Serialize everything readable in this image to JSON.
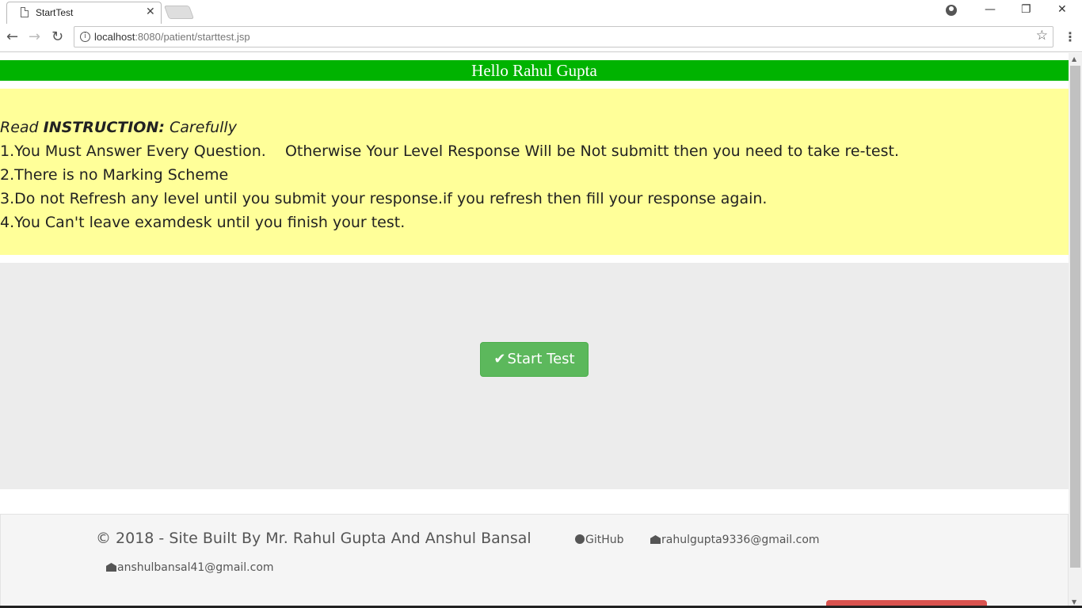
{
  "browser": {
    "tab_title": "StartTest",
    "url_host": "localhost",
    "url_rest": ":8080/patient/starttest.jsp"
  },
  "page": {
    "greeting": "Hello Rahul Gupta",
    "instructions": {
      "title_prefix": "Read ",
      "title_bold": "INSTRUCTION:",
      "title_suffix": " Carefully",
      "items": [
        "1.You Must Answer Every Question.    Otherwise Your Level Response Will be Not submitt then you need to take re-test.",
        "2.There is no Marking Scheme",
        "3.Do not Refresh any level until you submit your response.if you refresh then fill your response again.",
        "4.You Can't leave examdesk until you finish your test."
      ]
    },
    "start_button": "Start Test",
    "footer": {
      "copyright": "© 2018 - Site Built By Mr. Rahul Gupta And Anshul Bansal",
      "github": "GitHub",
      "email1": "rahulgupta9336@gmail.com",
      "email2": "anshulbansal41@gmail.com"
    }
  },
  "colors": {
    "greeting_bg": "#00b300",
    "instructions_bg": "#ffff99",
    "panel_bg": "#ececec",
    "start_button_bg": "#5cb85c"
  }
}
